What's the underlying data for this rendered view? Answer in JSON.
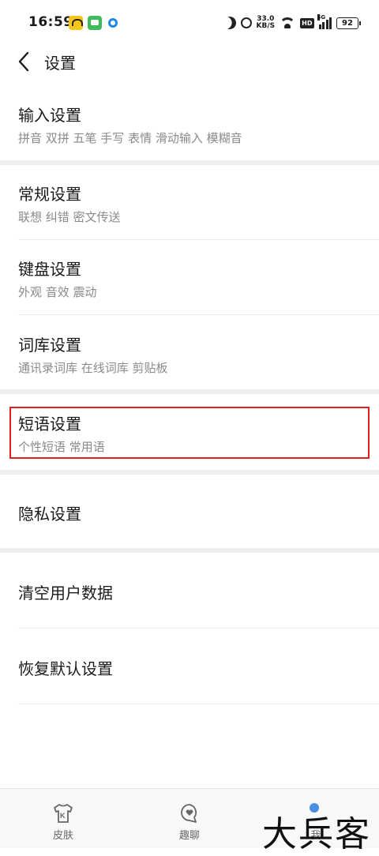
{
  "status_bar": {
    "time": "16:59",
    "speed_value": "33.0",
    "speed_unit": "KB/S",
    "network_type": "5G",
    "hd_label": "HD",
    "battery": "92"
  },
  "header": {
    "title": "设置"
  },
  "settings": {
    "input": {
      "label": "输入设置",
      "sub": "拼音 双拼 五笔 手写 表情 滑动输入 模糊音"
    },
    "general": {
      "label": "常规设置",
      "sub": "联想 纠错 密文传送"
    },
    "keyboard": {
      "label": "键盘设置",
      "sub": "外观 音效 震动"
    },
    "lexicon": {
      "label": "词库设置",
      "sub": "通讯录词库 在线词库 剪贴板"
    },
    "phrase": {
      "label": "短语设置",
      "sub": "个性短语 常用语"
    },
    "privacy": {
      "label": "隐私设置"
    },
    "clear_data": {
      "label": "清空用户数据"
    },
    "restore": {
      "label": "恢复默认设置"
    }
  },
  "bottom_nav": {
    "items": [
      {
        "label": "皮肤",
        "icon": "skin-shirt-icon"
      },
      {
        "label": "趣聊",
        "icon": "chat-heart-icon"
      },
      {
        "label": "我",
        "icon": "profile-icon"
      }
    ]
  },
  "watermark": "大兵客",
  "colors": {
    "highlight_border": "#e02020",
    "divider": "#eeeeee",
    "subtext": "#8a8a8a"
  }
}
